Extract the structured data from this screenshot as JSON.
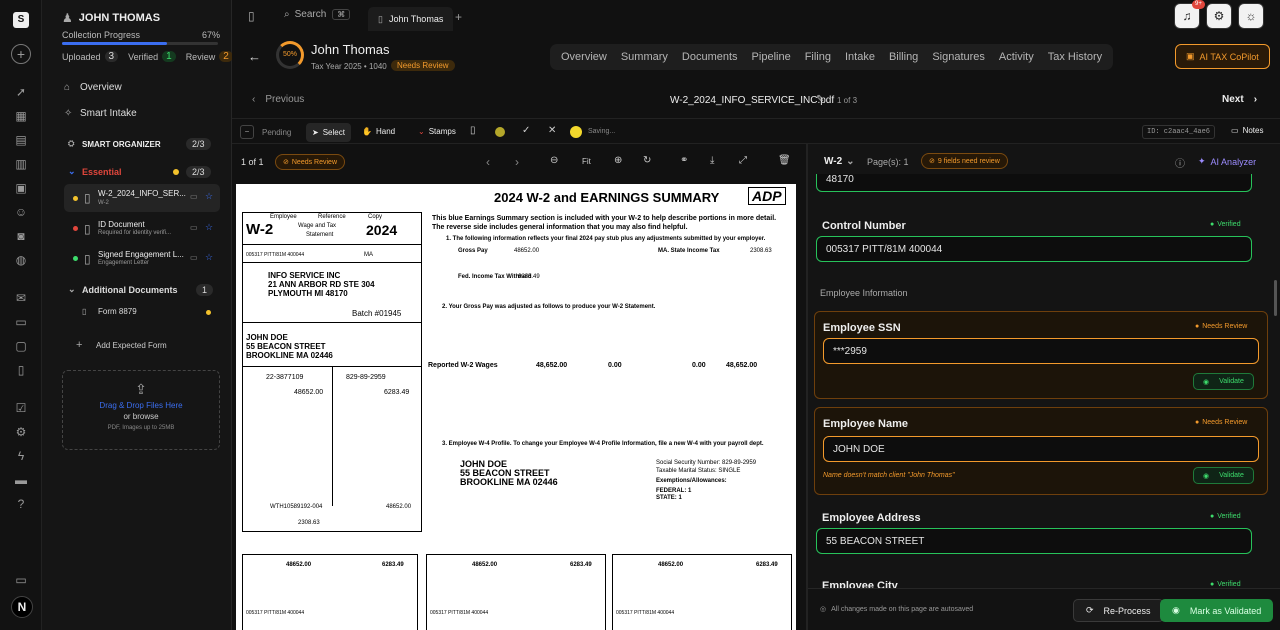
{
  "client": {
    "name": "JOHN THOMAS",
    "progress_label": "Collection Progress",
    "progress_pct": "67%",
    "progress_value": 0.67,
    "uploaded_label": "Uploaded",
    "uploaded": "3",
    "verified_label": "Verified",
    "verified": "1",
    "review_label": "Review",
    "review": "2"
  },
  "nav": {
    "overview": "Overview",
    "smart_intake": "Smart Intake",
    "organizer": "SMART ORGANIZER",
    "organizer_count": "2/3",
    "essential": "Essential",
    "essential_count": "2/3",
    "docs": [
      {
        "title": "W-2_2024_INFO_SER...",
        "sub": "W-2"
      },
      {
        "title": "ID Document",
        "sub": "Required for identity verifi..."
      },
      {
        "title": "Signed Engagement L...",
        "sub": "Engagement Letter"
      }
    ],
    "additional": "Additional Documents",
    "additional_count": "1",
    "form8879": "Form 8879",
    "add_expected": "Add Expected Form",
    "drop_title": "Drag & Drop Files Here",
    "drop_or": "or browse",
    "drop_hint": "PDF, Images up to 25MB"
  },
  "top": {
    "search": "Search",
    "shortcut": "⌘",
    "tab": "John Thomas",
    "notif_badge": "9+"
  },
  "header": {
    "pct": "50%",
    "name": "John Thomas",
    "meta": "Tax Year 2025 • 1040",
    "status": "Needs Review",
    "tabs": [
      "Overview",
      "Summary",
      "Documents",
      "Pipeline",
      "Filing",
      "Intake",
      "Billing",
      "Signatures",
      "Activity",
      "Tax History"
    ],
    "copilot": "AI TAX CoPilot"
  },
  "docnav": {
    "previous": "Previous",
    "filename": "W-2_2024_INFO_SERVICE_INC.pdf",
    "page_of": "1 of 3",
    "next": "Next"
  },
  "toolbar": {
    "pending": "Pending",
    "select": "Select",
    "hand": "Hand",
    "stamps": "Stamps",
    "saving": "Saving...",
    "id": "ID: c2aac4_4ae6",
    "notes": "Notes"
  },
  "viewer": {
    "page": "1 of 1",
    "status": "Needs Review",
    "fit": "Fit"
  },
  "panel": {
    "doc_type": "W-2",
    "pages": "Page(s): 1",
    "needs_review": "9 fields need review",
    "analyzer": "AI Analyzer",
    "top_value": "48170",
    "control_label": "Control Number",
    "control_value": "005317 PITT/81M 400044",
    "verified": "Verified",
    "section": "Employee Information",
    "ssn_label": "Employee SSN",
    "ssn_value": "***2959",
    "needs_review_tag": "Needs Review",
    "validate": "Validate",
    "name_label": "Employee Name",
    "name_value": "JOHN DOE",
    "name_warn": "Name doesn't match client \"John Thomas\"",
    "addr_label": "Employee Address",
    "addr_value": "55 BEACON STREET",
    "city_label": "Employee City",
    "autosave": "All changes made on this page are autosaved",
    "reprocess": "Re-Process",
    "mark": "Mark as Validated"
  },
  "w2": {
    "title": "2024 W-2 and EARNINGS SUMMARY",
    "logo": "ADP",
    "form": "W-2",
    "year": "2024",
    "wage": "Wage and Tax",
    "statement": "Statement",
    "employee": "Employee",
    "reference": "Reference",
    "copy": "Copy",
    "employer_lines": [
      "INFO SERVICE INC",
      "21 ANN ARBOR RD STE 304",
      "PLYMOUTH MI 48170"
    ],
    "batch": "Batch #01945",
    "employee_lines": [
      "JOHN DOE",
      "55 BEACON STREET",
      "BROOKLINE MA 02446"
    ],
    "ein": "22-3877109",
    "ssn": "829-89-2959",
    "wages": "48652.00",
    "fed_tax": "6283.49",
    "control": "005317 PITT/81M 400044",
    "state_wages": "48652.00",
    "state_tax": "2308.63",
    "state_id": "WTH10589192-004",
    "state": "MA",
    "intro": [
      "This blue Earnings Summary section is included with your W-2 to help describe portions in more detail.",
      "The reverse side includes general information that you may also find helpful."
    ],
    "s1": "1. The following information reflects your final 2024 pay stub plus any adjustments submitted by your employer.",
    "s2": "2. Your Gross Pay was adjusted as follows to produce your W-2 Statement.",
    "s3": "3. Employee W-4 Profile. To change your Employee W-4 Profile Information, file a new W-4 with your payroll dept.",
    "gross_pay": "Gross Pay",
    "gross_val": "48652.00",
    "fed_income": "Fed. Income Tax Withheld",
    "fed_val": "6283.49",
    "ma_tax": "MA. State Income Tax",
    "ma_val": "2308.63",
    "reported": "Reported W-2 Wages",
    "reported_vals": [
      "48,652.00",
      "0.00",
      "0.00",
      "48,652.00"
    ],
    "ssn_line": "Social Security Number: 829-89-2959",
    "marital": "Taxable Marital Status: SINGLE",
    "exemptions": "Exemptions/Allowances:",
    "federal": "FEDERAL: 1",
    "statel": "STATE: 1"
  }
}
